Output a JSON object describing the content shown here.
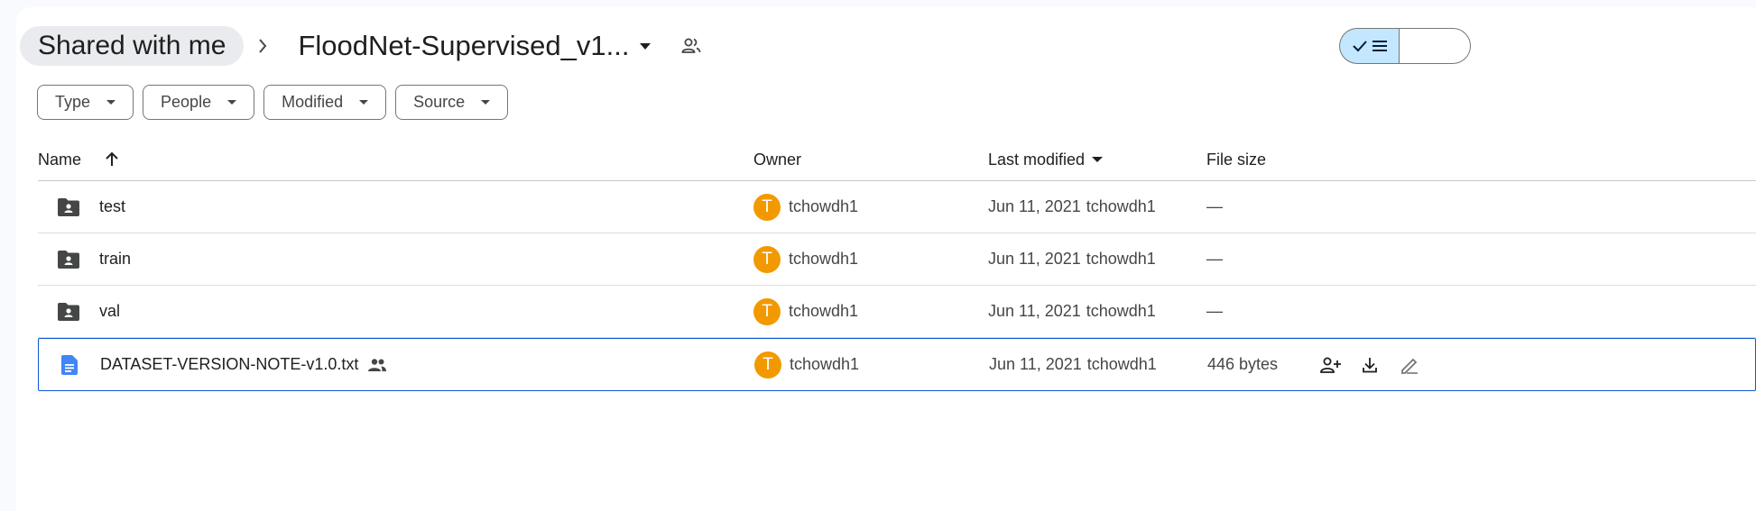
{
  "breadcrumb": {
    "parent_label": "Shared with me",
    "current_label": "FloodNet-Supervised_v1..."
  },
  "filters": [
    {
      "label": "Type"
    },
    {
      "label": "People"
    },
    {
      "label": "Modified"
    },
    {
      "label": "Source"
    }
  ],
  "columns": {
    "name": "Name",
    "owner": "Owner",
    "last_modified": "Last modified",
    "file_size": "File size"
  },
  "rows": [
    {
      "name": "test",
      "icon": "shared-folder-icon",
      "owner_initial": "T",
      "owner": "tchowdh1",
      "modified_date": "Jun 11, 2021",
      "modified_by": "tchowdh1",
      "size": "—"
    },
    {
      "name": "train",
      "icon": "shared-folder-icon",
      "owner_initial": "T",
      "owner": "tchowdh1",
      "modified_date": "Jun 11, 2021",
      "modified_by": "tchowdh1",
      "size": "—"
    },
    {
      "name": "val",
      "icon": "shared-folder-icon",
      "owner_initial": "T",
      "owner": "tchowdh1",
      "modified_date": "Jun 11, 2021",
      "modified_by": "tchowdh1",
      "size": "—"
    },
    {
      "name": "DATASET-VERSION-NOTE-v1.0.txt",
      "icon": "document-icon",
      "owner_initial": "T",
      "owner": "tchowdh1",
      "modified_date": "Jun 11, 2021",
      "modified_by": "tchowdh1",
      "size": "446 bytes",
      "selected": true
    }
  ],
  "colors": {
    "accent": "#0b57d0",
    "avatar": "#f29900",
    "toggle_active": "#c2e7ff",
    "doc_icon": "#4285f4"
  }
}
